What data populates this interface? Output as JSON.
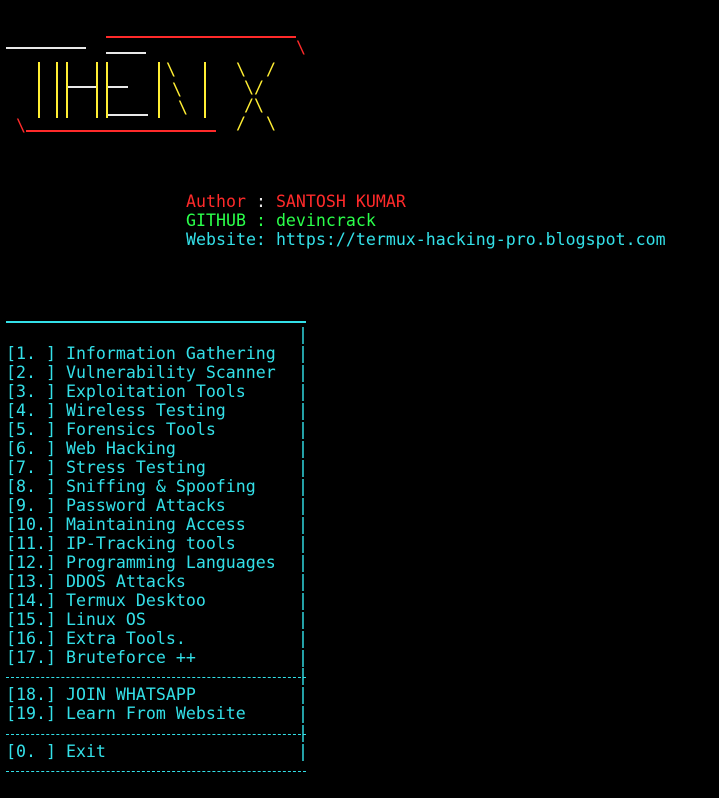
{
  "colors": {
    "background": "#000000",
    "cyan": "#33e0e8",
    "red": "#ff2a2a",
    "green": "#2aff4a",
    "yellow": "#ffee33",
    "white": "#e8e8e8"
  },
  "banner": {
    "ascii_text": "THEN X"
  },
  "info": {
    "author_label": "Author",
    "author_sep": " : ",
    "author_value": "SANTOSH KUMAR",
    "github_label": "GITHUB",
    "github_sep": " : ",
    "github_value": "devincrack",
    "website_label": "Website:",
    "website_value": "https://termux-hacking-pro.blogspot.com"
  },
  "menu": {
    "items": [
      {
        "key": "[1. ]",
        "label": "Information Gathering"
      },
      {
        "key": "[2. ]",
        "label": "Vulnerability Scanner"
      },
      {
        "key": "[3. ]",
        "label": "Exploitation Tools"
      },
      {
        "key": "[4. ]",
        "label": "Wireless Testing"
      },
      {
        "key": "[5. ]",
        "label": "Forensics Tools"
      },
      {
        "key": "[6. ]",
        "label": "Web Hacking"
      },
      {
        "key": "[7. ]",
        "label": "Stress Testing"
      },
      {
        "key": "[8. ]",
        "label": "Sniffing & Spoofing"
      },
      {
        "key": "[9. ]",
        "label": "Password Attacks"
      },
      {
        "key": "[10.]",
        "label": "Maintaining Access"
      },
      {
        "key": "[11.]",
        "label": "IP-Tracking tools"
      },
      {
        "key": "[12.]",
        "label": "Programming Languages"
      },
      {
        "key": "[13.]",
        "label": "DDOS Attacks"
      },
      {
        "key": "[14.]",
        "label": "Termux Desktoo"
      },
      {
        "key": "[15.]",
        "label": "Linux OS"
      },
      {
        "key": "[16.]",
        "label": "Extra Tools."
      },
      {
        "key": "[17.]",
        "label": "Bruteforce ++"
      }
    ],
    "extra_items": [
      {
        "key": "[18.]",
        "label": "JOIN WHATSAPP"
      },
      {
        "key": "[19.]",
        "label": "Learn From Website"
      }
    ],
    "exit_item": {
      "key": "[0. ]",
      "label": "Exit"
    },
    "edge_char": "|"
  }
}
